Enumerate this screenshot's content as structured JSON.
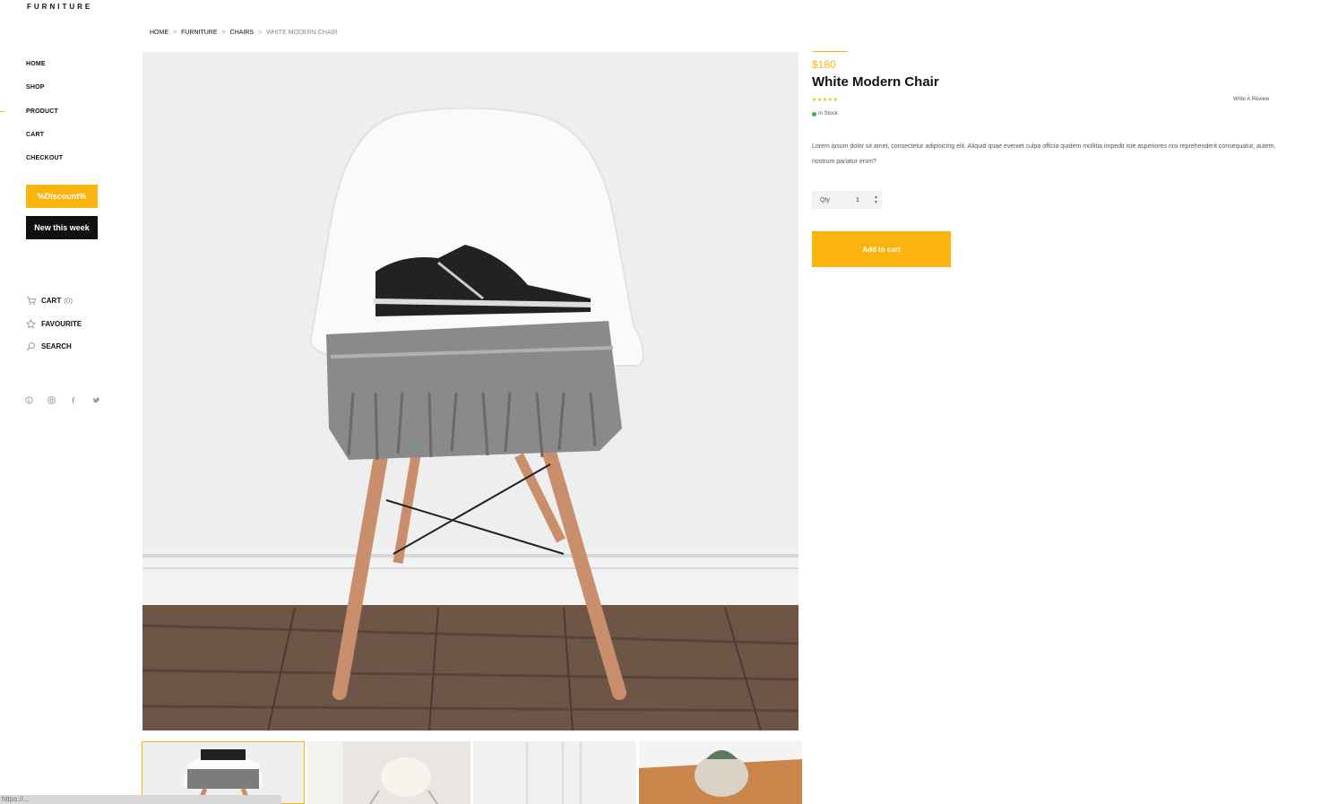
{
  "brand": {
    "logo": "FURNITURE"
  },
  "nav": {
    "items": [
      {
        "label": "HOME"
      },
      {
        "label": "SHOP"
      },
      {
        "label": "PRODUCT"
      },
      {
        "label": "CART"
      },
      {
        "label": "CHECKOUT"
      }
    ],
    "active": "PRODUCT"
  },
  "promo": {
    "discount_label": "%Discount%",
    "new_label": "New this week"
  },
  "side_links": {
    "cart_label": "CART",
    "cart_count": "(0)",
    "favourite_label": "FAVOURITE",
    "search_label": "SEARCH"
  },
  "social": {
    "icons": [
      "pinterest-icon",
      "instagram-icon",
      "facebook-icon",
      "twitter-icon"
    ]
  },
  "breadcrumb": {
    "items": [
      "HOME",
      "FURNITURE",
      "CHAIRS",
      "WHITE MODERN CHAIR"
    ],
    "separator": ">"
  },
  "product": {
    "price": "$180",
    "title": "White Modern Chair",
    "rating": 5,
    "stars": "★★★★★",
    "write_review": "Write A Review",
    "stock": "In Stock",
    "description": "Lorem ipsum dolor sit amet, consectetur adipisicing elit. Aliquid quae eveniet culpa officia quidem mollitia impedit iste asperiores nisi reprehenderit consequatur, autem, nostrum pariatur enim?",
    "qty_label": "Qty",
    "qty_value": "1",
    "add_to_cart": "Add to cart"
  },
  "status_bar": {
    "text": "https://..."
  },
  "colors": {
    "accent": "#fbb40f",
    "dark": "#111111",
    "in_stock": "#3ab54a"
  }
}
